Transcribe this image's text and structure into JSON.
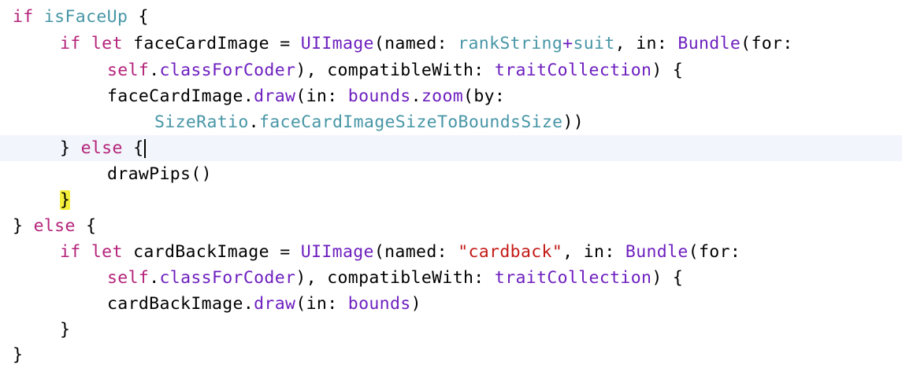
{
  "editor": {
    "language": "swift",
    "colors": {
      "keyword": "#b4237a",
      "type": "#6d1fbf",
      "property": "#4796a6",
      "string": "#c41a16",
      "plain": "#000000",
      "current_line_bg": "#f2f5fb",
      "bracket_highlight": "#f5ef3c"
    },
    "current_line": 5,
    "highlighted_bracket_line": 7,
    "lines": [
      {
        "indent": 0,
        "tokens": [
          {
            "t": "kw",
            "v": "if"
          },
          {
            "t": "pl",
            "v": " "
          },
          {
            "t": "pr",
            "v": "isFaceUp"
          },
          {
            "t": "pl",
            "v": " {"
          }
        ]
      },
      {
        "indent": 4,
        "tokens": [
          {
            "t": "kw",
            "v": "if"
          },
          {
            "t": "pl",
            "v": " "
          },
          {
            "t": "kw",
            "v": "let"
          },
          {
            "t": "pl",
            "v": " faceCardImage = "
          },
          {
            "t": "ty",
            "v": "UIImage"
          },
          {
            "t": "pl",
            "v": "(named: "
          },
          {
            "t": "pr",
            "v": "rankString"
          },
          {
            "t": "ty",
            "v": "+"
          },
          {
            "t": "pr",
            "v": "suit"
          },
          {
            "t": "pl",
            "v": ", in: "
          },
          {
            "t": "ty",
            "v": "Bundle"
          },
          {
            "t": "pl",
            "v": "(for:"
          }
        ]
      },
      {
        "indent": 8,
        "tokens": [
          {
            "t": "kw",
            "v": "self"
          },
          {
            "t": "pl",
            "v": "."
          },
          {
            "t": "ty",
            "v": "classForCoder"
          },
          {
            "t": "pl",
            "v": "), compatibleWith: "
          },
          {
            "t": "ty",
            "v": "traitCollection"
          },
          {
            "t": "pl",
            "v": ") {"
          }
        ]
      },
      {
        "indent": 8,
        "tokens": [
          {
            "t": "pl",
            "v": "faceCardImage."
          },
          {
            "t": "ty",
            "v": "draw"
          },
          {
            "t": "pl",
            "v": "(in: "
          },
          {
            "t": "ty",
            "v": "bounds"
          },
          {
            "t": "pl",
            "v": "."
          },
          {
            "t": "ty",
            "v": "zoom"
          },
          {
            "t": "pl",
            "v": "(by:"
          }
        ]
      },
      {
        "indent": 12,
        "tokens": [
          {
            "t": "pr",
            "v": "SizeRatio"
          },
          {
            "t": "pl",
            "v": "."
          },
          {
            "t": "pr",
            "v": "faceCardImageSizeToBoundsSize"
          },
          {
            "t": "pl",
            "v": "))"
          }
        ]
      },
      {
        "indent": 4,
        "tokens": [
          {
            "t": "pl",
            "v": "} "
          },
          {
            "t": "kw",
            "v": "else"
          },
          {
            "t": "pl",
            "v": " {"
          },
          {
            "t": "cursor",
            "v": ""
          }
        ]
      },
      {
        "indent": 8,
        "tokens": [
          {
            "t": "pl",
            "v": "drawPips()"
          }
        ]
      },
      {
        "indent": 4,
        "tokens": [
          {
            "t": "hl",
            "v": "}"
          }
        ]
      },
      {
        "indent": 0,
        "tokens": [
          {
            "t": "pl",
            "v": "} "
          },
          {
            "t": "kw",
            "v": "else"
          },
          {
            "t": "pl",
            "v": " {"
          }
        ]
      },
      {
        "indent": 4,
        "tokens": [
          {
            "t": "kw",
            "v": "if"
          },
          {
            "t": "pl",
            "v": " "
          },
          {
            "t": "kw",
            "v": "let"
          },
          {
            "t": "pl",
            "v": " cardBackImage = "
          },
          {
            "t": "ty",
            "v": "UIImage"
          },
          {
            "t": "pl",
            "v": "(named: "
          },
          {
            "t": "st",
            "v": "\"cardback\""
          },
          {
            "t": "pl",
            "v": ", in: "
          },
          {
            "t": "ty",
            "v": "Bundle"
          },
          {
            "t": "pl",
            "v": "(for:"
          }
        ]
      },
      {
        "indent": 8,
        "tokens": [
          {
            "t": "kw",
            "v": "self"
          },
          {
            "t": "pl",
            "v": "."
          },
          {
            "t": "ty",
            "v": "classForCoder"
          },
          {
            "t": "pl",
            "v": "), compatibleWith: "
          },
          {
            "t": "ty",
            "v": "traitCollection"
          },
          {
            "t": "pl",
            "v": ") {"
          }
        ]
      },
      {
        "indent": 8,
        "tokens": [
          {
            "t": "pl",
            "v": "cardBackImage."
          },
          {
            "t": "ty",
            "v": "draw"
          },
          {
            "t": "pl",
            "v": "(in: "
          },
          {
            "t": "ty",
            "v": "bounds"
          },
          {
            "t": "pl",
            "v": ")"
          }
        ]
      },
      {
        "indent": 4,
        "tokens": [
          {
            "t": "pl",
            "v": "}"
          }
        ]
      },
      {
        "indent": 0,
        "tokens": [
          {
            "t": "pl",
            "v": "}"
          }
        ]
      }
    ]
  }
}
